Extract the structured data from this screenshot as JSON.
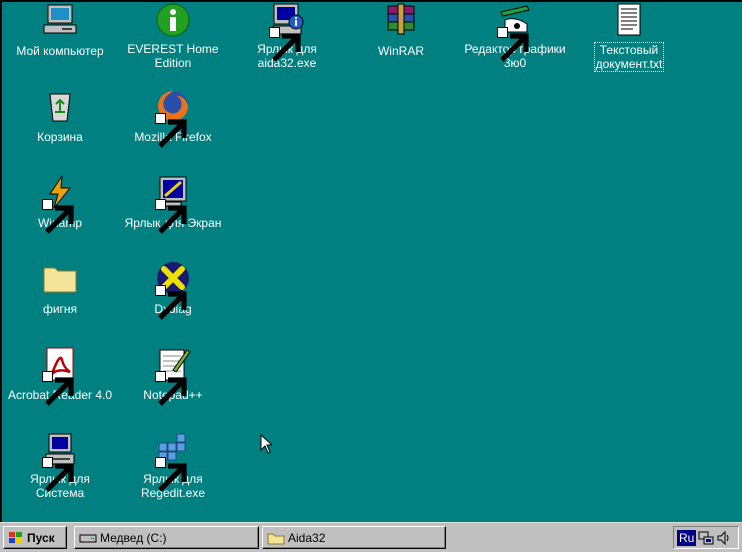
{
  "desktop": {
    "icons": [
      {
        "label": "Мой компьютер",
        "icon": "my-computer-icon",
        "shortcut": false
      },
      {
        "label": "EVEREST Home\nEdition",
        "icon": "everest-info-icon",
        "shortcut": false
      },
      {
        "label": "Ярлык для\naida32.exe",
        "icon": "aida32-icon",
        "shortcut": true
      },
      {
        "label": "WinRAR",
        "icon": "winrar-icon",
        "shortcut": false
      },
      {
        "label": "Редактор графики\n3ю0",
        "icon": "graphics-editor-icon",
        "shortcut": true
      },
      {
        "label": "Текстовый\nдокумент.txt",
        "icon": "text-document-icon",
        "shortcut": false,
        "selected": true
      },
      {
        "label": "Корзина",
        "icon": "recycle-bin-icon",
        "shortcut": false
      },
      {
        "label": "Mozilla Firefox",
        "icon": "firefox-icon",
        "shortcut": true
      },
      {
        "label": "Winamp",
        "icon": "winamp-icon",
        "shortcut": true
      },
      {
        "label": "Ярлык для Экран",
        "icon": "display-icon",
        "shortcut": true
      },
      {
        "label": "фигня",
        "icon": "folder-icon",
        "shortcut": false
      },
      {
        "label": "Dxdiag",
        "icon": "dxdiag-icon",
        "shortcut": true
      },
      {
        "label": "Acrobat Reader 4.0",
        "icon": "acrobat-icon",
        "shortcut": true
      },
      {
        "label": "Notepad++",
        "icon": "notepadpp-icon",
        "shortcut": true
      },
      {
        "label": "Ярлык для\nСистема",
        "icon": "system-computer-icon",
        "shortcut": true
      },
      {
        "label": "Ярлык для\nRegedit.exe",
        "icon": "regedit-icon",
        "shortcut": true
      }
    ]
  },
  "taskbar": {
    "start_label": "Пуск",
    "tasks": [
      {
        "label": "Медвед (C:)",
        "icon": "drive-icon"
      },
      {
        "label": "Aida32",
        "icon": "folder-icon"
      }
    ],
    "tray": {
      "language": "Ru",
      "icons": [
        "network-icon",
        "volume-icon"
      ]
    }
  },
  "colors": {
    "desktop": "#008080",
    "taskbar": "#c0c0c0",
    "tray_lang": "#000080"
  }
}
